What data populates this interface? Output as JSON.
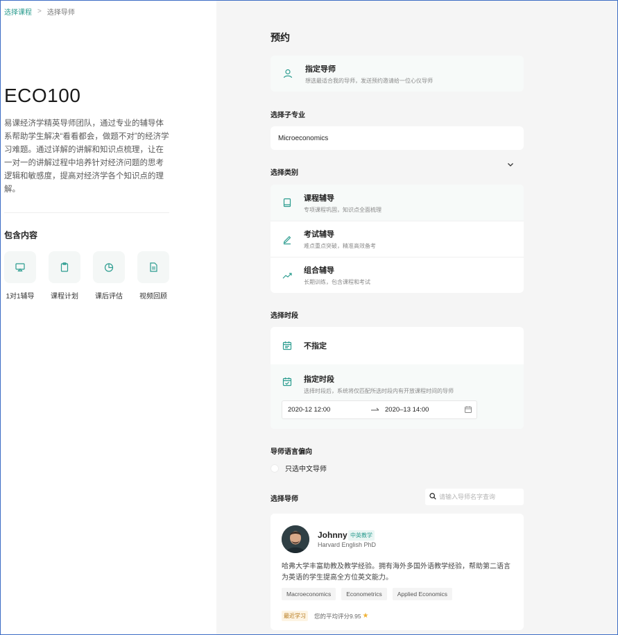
{
  "breadcrumb": {
    "parent": "选择课程",
    "separator": ">",
    "current": "选择导师"
  },
  "course": {
    "code": "ECO100",
    "description": "易课经济学精英导师团队，通过专业的辅导体系帮助学生解决“看看都会，做题不对”的经济学习难题。通过详解的讲解和知识点梳理，让在一对一的讲解过程中培养针对经济问题的思考逻辑和敏感度，提高对经济学各个知识点的理解。"
  },
  "includes": {
    "title": "包含内容",
    "items": [
      {
        "label": "1对1辅导",
        "icon": "screen-share-icon"
      },
      {
        "label": "课程计划",
        "icon": "clipboard-icon"
      },
      {
        "label": "课后评估",
        "icon": "pie-chart-icon"
      },
      {
        "label": "视频回顾",
        "icon": "document-icon"
      }
    ]
  },
  "booking": {
    "title": "预约",
    "designate": {
      "title": "指定导师",
      "subtitle": "想选最适合我的导师，发送预约邀请给一位心仪导师"
    },
    "subject": {
      "label": "选择子专业",
      "value": "Microeconomics"
    },
    "category": {
      "label": "选择类别",
      "options": [
        {
          "title": "课程辅导",
          "subtitle": "专项课程巩固，知识点全面梳理",
          "icon": "book-icon",
          "selected": true
        },
        {
          "title": "考试辅导",
          "subtitle": "难点重点突破，精准高效备考",
          "icon": "pen-icon",
          "selected": false
        },
        {
          "title": "组合辅导",
          "subtitle": "长期训练，包含课程和考试",
          "icon": "trend-icon",
          "selected": false
        }
      ]
    },
    "time": {
      "label": "选择时段",
      "unspecified": "不指定",
      "specified": {
        "title": "指定时段",
        "subtitle": "选择时段后，系统将仅匹配所选时段内有开放课程时间的导师",
        "start": "2020-12 12:00",
        "end": "2020–13 14:00"
      }
    },
    "language": {
      "label": "导师语言偏向",
      "option": "只选中文导师",
      "checked": false
    },
    "tutor": {
      "label": "选择导师",
      "search_placeholder": "请输入导师名字查询",
      "card": {
        "name": "Johnny",
        "tag": "中英教学",
        "degree": "Harvard English PhD",
        "bio": "哈弗大学丰富助教及教学经验。拥有海外多国外语教学经验，帮助第二语言为英语的学生提高全方位英文能力。",
        "chips": [
          "Macroeconomics",
          "Econometrics",
          "Applied Economics"
        ],
        "recent_badge": "最近学习",
        "rating_text": "您的平均评分9.95",
        "rating_icon": "star-icon"
      }
    }
  },
  "colors": {
    "accent": "#2b9c8f",
    "panel_bg": "#f5f5f5",
    "star": "#f0b234"
  }
}
